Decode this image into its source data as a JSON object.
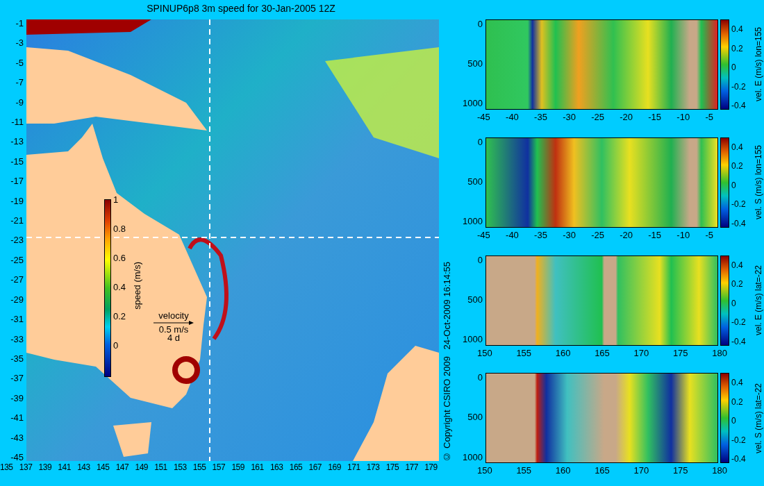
{
  "title": "SPINUP6p8 3m speed for 30-Jan-2005 12Z",
  "map": {
    "y_ticks": [
      "-1",
      "-3",
      "-5",
      "-7",
      "-9",
      "-11",
      "-13",
      "-15",
      "-17",
      "-19",
      "-21",
      "-23",
      "-25",
      "-27",
      "-29",
      "-31",
      "-33",
      "-35",
      "-37",
      "-39",
      "-41",
      "-43",
      "-45"
    ],
    "x_ticks": [
      "135",
      "137",
      "139",
      "141",
      "143",
      "145",
      "147",
      "149",
      "151",
      "153",
      "155",
      "157",
      "159",
      "161",
      "163",
      "165",
      "167",
      "169",
      "171",
      "173",
      "175",
      "177",
      "179"
    ],
    "colorbar": {
      "label": "speed (m/s)",
      "ticks": [
        "1",
        "0.8",
        "0.6",
        "0.4",
        "0.2",
        "0"
      ]
    },
    "velocity_legend": {
      "label": "velocity",
      "scale": "0.5 m/s",
      "duration": "4 d"
    }
  },
  "copyright": "© Copyright CSIRO 2009",
  "timestamp": "24-Oct-2009 16:14:55",
  "sections": [
    {
      "label": "vel. E (m/s) lon=155",
      "y_ticks": [
        "0",
        "500",
        "1000"
      ],
      "x_ticks": [
        "-45",
        "-40",
        "-35",
        "-30",
        "-25",
        "-20",
        "-15",
        "-10",
        "-5"
      ],
      "colorbar_ticks": [
        "0.4",
        "0.2",
        "0",
        "-0.2",
        "-0.4"
      ]
    },
    {
      "label": "vel. S (m/s) lon=155",
      "y_ticks": [
        "0",
        "500",
        "1000"
      ],
      "x_ticks": [
        "-45",
        "-40",
        "-35",
        "-30",
        "-25",
        "-20",
        "-15",
        "-10",
        "-5"
      ],
      "colorbar_ticks": [
        "0.4",
        "0.2",
        "0",
        "-0.2",
        "-0.4"
      ]
    },
    {
      "label": "vel. E (m/s) lat=-22",
      "y_ticks": [
        "0",
        "500",
        "1000"
      ],
      "x_ticks": [
        "150",
        "155",
        "160",
        "165",
        "170",
        "175",
        "180"
      ],
      "colorbar_ticks": [
        "0.4",
        "0.2",
        "0",
        "-0.2",
        "-0.4"
      ]
    },
    {
      "label": "vel. S (m/s) lat=-22",
      "y_ticks": [
        "0",
        "500",
        "1000"
      ],
      "x_ticks": [
        "150",
        "155",
        "160",
        "165",
        "170",
        "175",
        "180"
      ],
      "colorbar_ticks": [
        "0.4",
        "0.2",
        "0",
        "-0.2",
        "-0.4"
      ]
    }
  ]
}
